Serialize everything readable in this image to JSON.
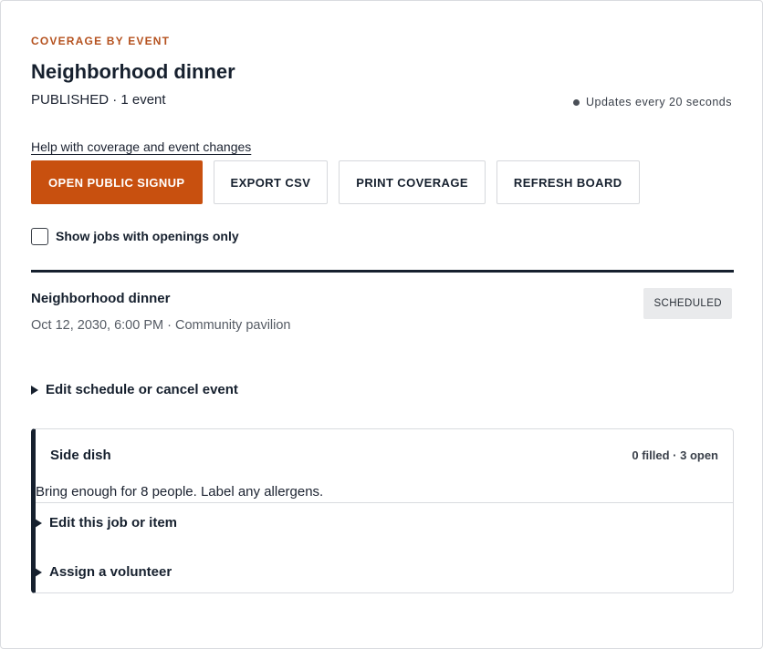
{
  "header": {
    "eyebrow": "COVERAGE BY EVENT",
    "title": "Neighborhood dinner",
    "subtitle": "PUBLISHED · 1 event",
    "updates": "Updates every 20 seconds",
    "help_link": "Help with coverage and event changes"
  },
  "toolbar": {
    "open_signup": "OPEN PUBLIC SIGNUP",
    "export_csv": "EXPORT CSV",
    "print_coverage": "PRINT COVERAGE",
    "refresh_board": "REFRESH BOARD"
  },
  "filter": {
    "openings_only_label": "Show jobs with openings only",
    "openings_only_checked": false
  },
  "event": {
    "name": "Neighborhood dinner",
    "meta": "Oct 12, 2030, 6:00 PM · Community pavilion",
    "status": "SCHEDULED",
    "edit_disclosure": "Edit schedule or cancel event"
  },
  "jobs": [
    {
      "title": "Side dish",
      "counts": "0 filled · 3 open",
      "description": "Bring enough for 8 people. Label any allergens.",
      "edit_disclosure": "Edit this job or item",
      "assign_disclosure": "Assign a volunteer"
    }
  ],
  "colors": {
    "accent": "#c8500f",
    "eyebrow": "#b5521f",
    "ink": "#16202e"
  },
  "icons": {
    "status_dot": "status-dot-icon",
    "disclosure": "disclosure-triangle-icon"
  }
}
